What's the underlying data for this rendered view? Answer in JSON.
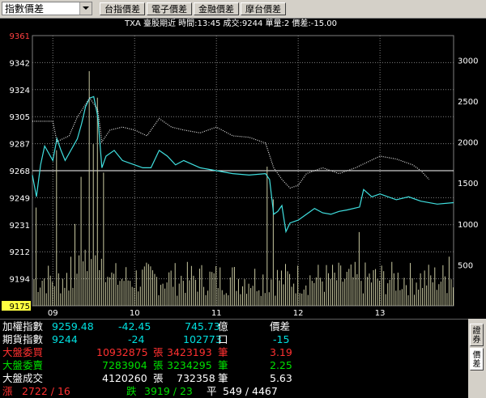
{
  "toolbar": {
    "combo_value": "指數價差",
    "buttons": [
      "台指價差",
      "電子價差",
      "金融價差",
      "摩台價差"
    ]
  },
  "chart": {
    "header": "TXA   臺股期近 時間:13:45 成交:9244 單量:2   價差:-15.00",
    "colors": {
      "price_line": "#40e0e0",
      "index_line": "#e0e0e0",
      "volume_bars": "#c8c8a0",
      "grid": "#808080",
      "axis_text": "#ffffff",
      "top_label": "#ff4040"
    },
    "left_axis": {
      "labels": [
        "9361",
        "9342",
        "9324",
        "9305",
        "9287",
        "9268",
        "9249",
        "9231",
        "9212",
        "9194",
        "9175"
      ],
      "highlight_top": true,
      "highlight_bottom": true
    },
    "right_axis": {
      "labels": [
        "3000",
        "2500",
        "2000",
        "1500",
        "1000",
        "500"
      ]
    },
    "x_axis": {
      "labels": [
        "09",
        "10",
        "11",
        "12",
        "13"
      ]
    }
  },
  "chart_data": {
    "type": "line",
    "title": "",
    "xlabel": "",
    "ylabel": "",
    "x_ticks": [
      "09",
      "10",
      "11",
      "12",
      "13"
    ],
    "ylim": [
      9175,
      9361
    ],
    "y2lim": [
      0,
      3300
    ],
    "reference_line": 9268,
    "series": [
      {
        "color": "#40e0e0",
        "style": "solid",
        "points": [
          [
            8.75,
            9265
          ],
          [
            8.8,
            9250
          ],
          [
            8.85,
            9272
          ],
          [
            8.9,
            9285
          ],
          [
            8.95,
            9280
          ],
          [
            9.0,
            9275
          ],
          [
            9.05,
            9290
          ],
          [
            9.1,
            9282
          ],
          [
            9.15,
            9275
          ],
          [
            9.2,
            9280
          ],
          [
            9.3,
            9290
          ],
          [
            9.35,
            9300
          ],
          [
            9.4,
            9312
          ],
          [
            9.45,
            9318
          ],
          [
            9.5,
            9319
          ],
          [
            9.55,
            9305
          ],
          [
            9.6,
            9270
          ],
          [
            9.65,
            9278
          ],
          [
            9.75,
            9282
          ],
          [
            9.85,
            9275
          ],
          [
            10.0,
            9272
          ],
          [
            10.1,
            9270
          ],
          [
            10.2,
            9270
          ],
          [
            10.3,
            9282
          ],
          [
            10.4,
            9278
          ],
          [
            10.5,
            9272
          ],
          [
            10.6,
            9275
          ],
          [
            10.8,
            9270
          ],
          [
            11.0,
            9268
          ],
          [
            11.2,
            9266
          ],
          [
            11.4,
            9265
          ],
          [
            11.6,
            9266
          ],
          [
            11.65,
            9262
          ],
          [
            11.7,
            9238
          ],
          [
            11.75,
            9240
          ],
          [
            11.8,
            9244
          ],
          [
            11.85,
            9226
          ],
          [
            11.9,
            9232
          ],
          [
            12.0,
            9234
          ],
          [
            12.1,
            9238
          ],
          [
            12.2,
            9242
          ],
          [
            12.3,
            9239
          ],
          [
            12.4,
            9238
          ],
          [
            12.5,
            9240
          ],
          [
            12.6,
            9241
          ],
          [
            12.75,
            9243
          ],
          [
            12.8,
            9255
          ],
          [
            12.9,
            9250
          ],
          [
            13.0,
            9252
          ],
          [
            13.2,
            9248
          ],
          [
            13.35,
            9250
          ],
          [
            13.5,
            9247
          ],
          [
            13.7,
            9245
          ],
          [
            13.9,
            9246
          ]
        ]
      },
      {
        "color": "#e0e0e0",
        "style": "dotted",
        "points": [
          [
            8.75,
            9302
          ],
          [
            9.0,
            9302
          ],
          [
            9.05,
            9288
          ],
          [
            9.2,
            9292
          ],
          [
            9.3,
            9305
          ],
          [
            9.45,
            9318
          ],
          [
            9.55,
            9310
          ],
          [
            9.6,
            9288
          ],
          [
            9.7,
            9296
          ],
          [
            9.85,
            9298
          ],
          [
            10.0,
            9296
          ],
          [
            10.15,
            9292
          ],
          [
            10.3,
            9304
          ],
          [
            10.45,
            9298
          ],
          [
            10.6,
            9296
          ],
          [
            10.8,
            9294
          ],
          [
            11.0,
            9298
          ],
          [
            11.2,
            9292
          ],
          [
            11.4,
            9291
          ],
          [
            11.6,
            9287
          ],
          [
            11.7,
            9270
          ],
          [
            11.8,
            9262
          ],
          [
            11.9,
            9256
          ],
          [
            12.0,
            9258
          ],
          [
            12.1,
            9266
          ],
          [
            12.3,
            9270
          ],
          [
            12.5,
            9266
          ],
          [
            12.7,
            9270
          ],
          [
            12.85,
            9274
          ],
          [
            13.0,
            9278
          ],
          [
            13.2,
            9276
          ],
          [
            13.4,
            9272
          ],
          [
            13.5,
            9268
          ],
          [
            13.6,
            9262
          ]
        ]
      }
    ]
  },
  "info": {
    "row1": {
      "label": "加權指數",
      "value": "9259.48",
      "change": "-42.45",
      "amount": "745.73",
      "amount_unit": "億",
      "spread_label": "價差"
    },
    "row2": {
      "label": "期貨指數",
      "value": "9244",
      "change": "-24",
      "volume": "102773",
      "volume_unit": "口",
      "spread": "-15"
    },
    "row3": {
      "label": "大盤委買",
      "shares": "10932875",
      "shares_unit": "張",
      "count": "3423193",
      "count_unit": "筆",
      "ratio": "3.19"
    },
    "row4": {
      "label": "大盤委賣",
      "shares": "7283904",
      "shares_unit": "張",
      "count": "3234295",
      "count_unit": "筆",
      "ratio": "2.25"
    },
    "row5": {
      "label": "大盤成交",
      "shares": "4120260",
      "shares_unit": "張",
      "count": "732358",
      "count_unit": "筆",
      "ratio": "5.63"
    },
    "row6": {
      "up_label": "漲",
      "up_value": "2722 / 16",
      "down_label": "跌",
      "down_value": "3919 / 23",
      "flat_label": "平",
      "flat_value": "549 / 4467"
    }
  },
  "side_tabs": [
    "證券",
    "價差"
  ]
}
